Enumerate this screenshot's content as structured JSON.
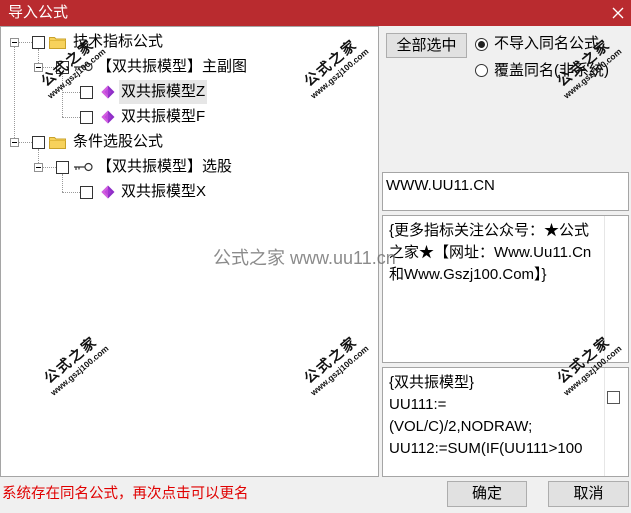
{
  "window": {
    "title": "导入公式",
    "close_icon": "close-icon"
  },
  "theme": {
    "title_bar": "#b92b2f",
    "status_text": "#e00000"
  },
  "tree": {
    "nodes": [
      {
        "label": "技术指标公式",
        "icon": "folder-icon",
        "level": 0,
        "expanded": true,
        "checked": false,
        "selected": false
      },
      {
        "label": "【双共振模型】主副图",
        "icon": "key-icon",
        "level": 1,
        "expanded": true,
        "checked": false,
        "selected": false
      },
      {
        "label": "双共振模型Z",
        "icon": "diamond-icon",
        "level": 2,
        "checked": false,
        "selected": true
      },
      {
        "label": "双共振模型F",
        "icon": "diamond-icon",
        "level": 2,
        "checked": false,
        "selected": false
      },
      {
        "label": "条件选股公式",
        "icon": "folder-icon",
        "level": 0,
        "expanded": true,
        "checked": false,
        "selected": false
      },
      {
        "label": "【双共振模型】选股",
        "icon": "key-icon",
        "level": 1,
        "expanded": true,
        "checked": false,
        "selected": false
      },
      {
        "label": "双共振模型X",
        "icon": "diamond-icon",
        "level": 2,
        "checked": false,
        "selected": false
      }
    ]
  },
  "options": {
    "select_all_label": "全部选中",
    "radio_options": [
      {
        "label": "不导入同名公式",
        "checked": true
      },
      {
        "label": "覆盖同名(非系统)",
        "checked": false
      }
    ]
  },
  "info": {
    "url_value": "WWW.UU11.CN",
    "description_lines": [
      "{更多指标关注公众号：★公式",
      "之家★【网址：Www.Uu11.Cn",
      "和Www.Gszj100.Com】}"
    ],
    "source_lines": [
      "{双共振模型}",
      "UU111:=",
      "(VOL/C)/2,NODRAW;",
      "UU112:=SUM(IF(UU111>100"
    ],
    "source_option_checked": false
  },
  "status": {
    "message": "系统存在同名公式，再次点击可以更名"
  },
  "buttons": {
    "ok_label": "确定",
    "cancel_label": "取消"
  },
  "watermarks": {
    "center_text": "公式之家 www.uu11.cn",
    "stamp_title": "公式之家",
    "stamp_url": "www.gszj100.com"
  }
}
